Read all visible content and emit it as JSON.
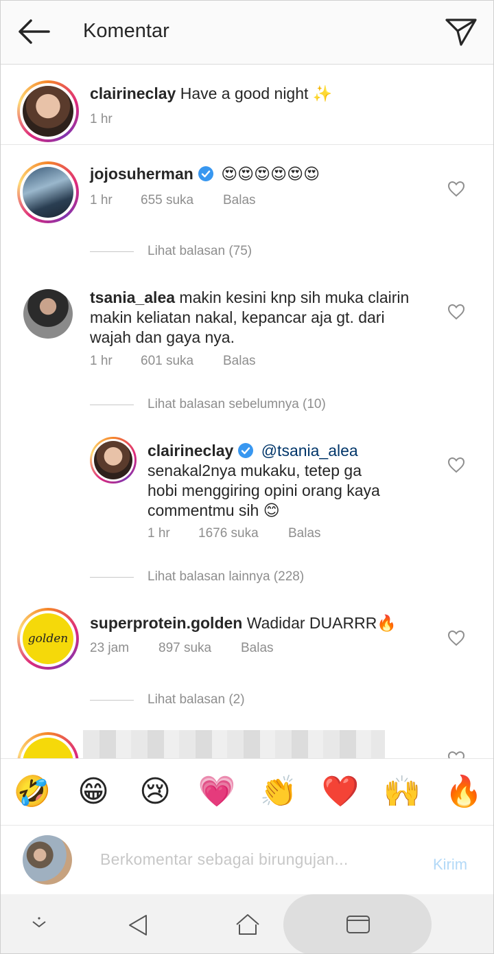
{
  "header": {
    "title": "Komentar",
    "back_icon": "back-arrow-icon",
    "send_icon": "paper-plane-icon"
  },
  "caption": {
    "username": "clairineclay",
    "text": "Have a good night ✨",
    "time": "1 hr"
  },
  "comments": [
    {
      "username": "jojosuherman",
      "verified": true,
      "text": "😍😍😍😍😍😍",
      "time": "1 hr",
      "likes": "655 suka",
      "reply": "Balas",
      "view_replies": "Lihat balasan (75)"
    },
    {
      "username": "tsania_alea",
      "verified": false,
      "text_line1": "makin kesini knp sih muka clairin",
      "text_line2": "makin keliatan nakal, kepancar aja gt. dari",
      "text_line3": "wajah dan gaya nya.",
      "time": "1 hr",
      "likes": "601 suka",
      "reply": "Balas",
      "view_prev": "Lihat balasan sebelumnya (10)"
    },
    {
      "username": "clairineclay",
      "verified": true,
      "mention": "@tsania_alea",
      "text_line1": "senakal2nya mukaku, tetep ga",
      "text_line2": "hobi menggiring opini orang kaya",
      "text_line3": "commentmu sih 😊",
      "time": "1 hr",
      "likes": "1676 suka",
      "reply": "Balas",
      "view_more": "Lihat balasan lainnya (228)"
    },
    {
      "username": "superprotein.golden",
      "verified": false,
      "text": "Wadidar DUARRR🔥",
      "time": "23 jam",
      "likes": "897 suka",
      "reply": "Balas",
      "view_replies": "Lihat balasan (2)",
      "avatar_text": "golden"
    }
  ],
  "emoji_bar": [
    "🤣",
    "😁",
    "😢",
    "💗",
    "👏",
    "❤️",
    "🙌",
    "🔥"
  ],
  "input": {
    "placeholder": "Berkomentar sebagai birungujan...",
    "send_label": "Kirim"
  },
  "navbar": {
    "icons": [
      "hide-keyboard-icon",
      "nav-back-icon",
      "home-icon",
      "recents-icon"
    ]
  }
}
